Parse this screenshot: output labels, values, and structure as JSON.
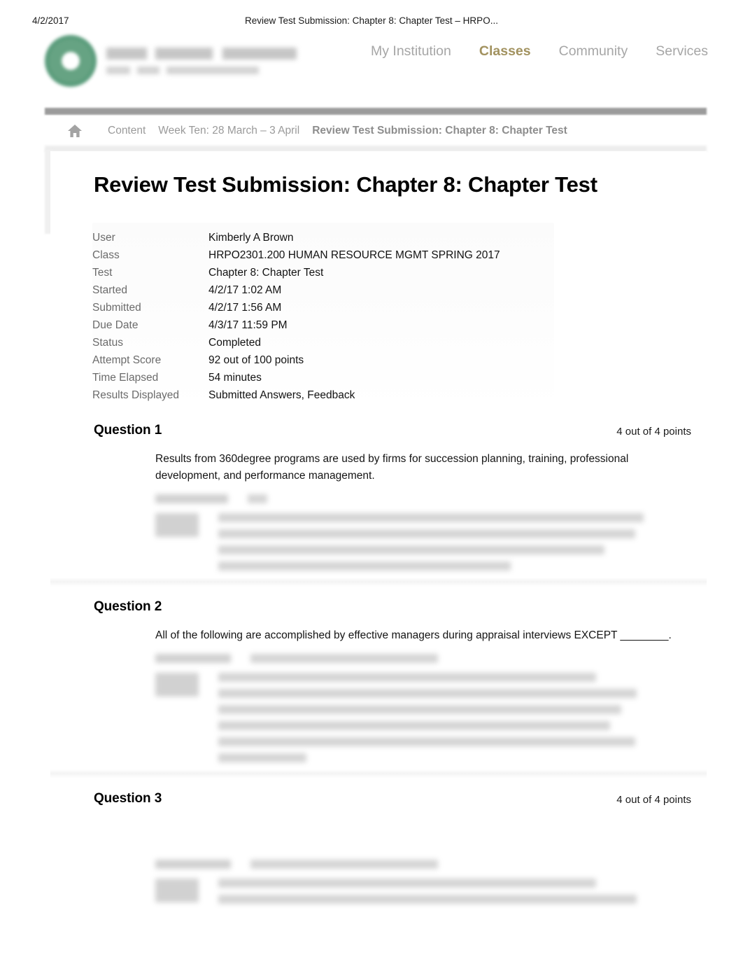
{
  "print_header": {
    "date": "4/2/2017",
    "title": "Review Test Submission: Chapter 8: Chapter Test – HRPO..."
  },
  "site_header": {
    "logo_name": "institution-seal-logo",
    "brand_color": "#4d9471",
    "nav": [
      {
        "label": "My Institution",
        "active": false
      },
      {
        "label": "Classes",
        "active": true
      },
      {
        "label": "Community",
        "active": false
      },
      {
        "label": "Services",
        "active": false
      }
    ],
    "active_nav_color": "#a2925f",
    "inactive_nav_color": "#a6a6a6"
  },
  "breadcrumb": {
    "home_icon": "home-icon",
    "crumbs": [
      {
        "label": "Content",
        "current": false
      },
      {
        "label": "Week Ten: 28 March – 3 April",
        "current": false
      },
      {
        "label": "Review Test Submission: Chapter 8: Chapter Test",
        "current": true
      }
    ]
  },
  "page_title": "Review Test Submission: Chapter 8: Chapter Test",
  "details": {
    "rows": [
      {
        "label": "User",
        "value": "Kimberly A Brown"
      },
      {
        "label": "Class",
        "value": "HRPO2301.200  HUMAN RESOURCE MGMT  SPRING 2017"
      },
      {
        "label": "Test",
        "value": "Chapter 8: Chapter Test"
      },
      {
        "label": "Started",
        "value": "4/2/17 1:02 AM"
      },
      {
        "label": "Submitted",
        "value": "4/2/17 1:56 AM"
      },
      {
        "label": "Due Date",
        "value": "4/3/17 11:59 PM"
      },
      {
        "label": "Status",
        "value": "Completed"
      },
      {
        "label": "Attempt Score",
        "value": "92 out of 100 points"
      },
      {
        "label": "Time Elapsed",
        "value": "54 minutes"
      },
      {
        "label": "Results Displayed",
        "value": "Submitted Answers, Feedback"
      }
    ]
  },
  "questions": [
    {
      "title": "Question 1",
      "points": "4 out of 4 points",
      "text": "Results from 360degree programs are used by firms for succession planning, training, professional development, and performance management."
    },
    {
      "title": "Question 2",
      "points": "",
      "text": "All of the following are accomplished by effective managers during appraisal interviews EXCEPT ________."
    },
    {
      "title": "Question 3",
      "points": "4 out of 4 points",
      "text": ""
    }
  ]
}
